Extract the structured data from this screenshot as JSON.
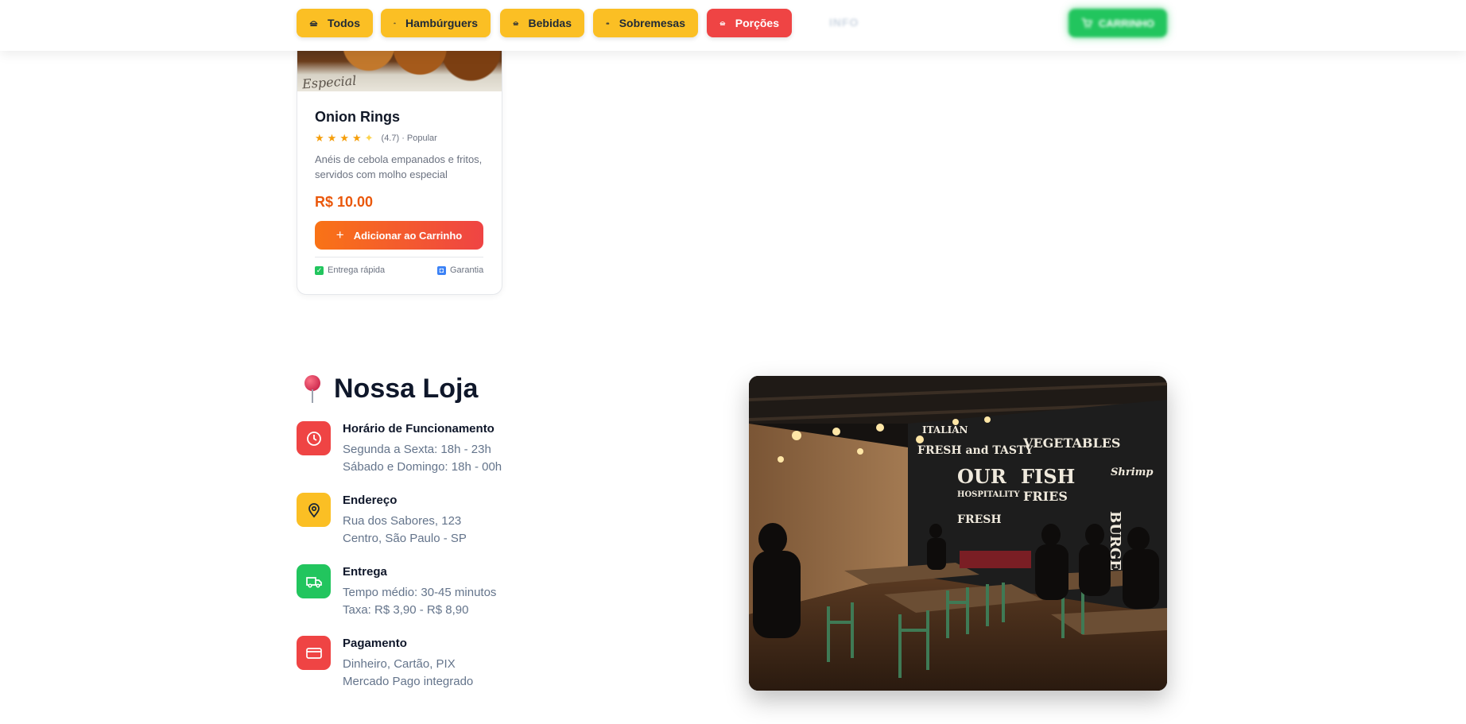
{
  "nav": {
    "categories": [
      {
        "label": "Todos",
        "icon": "burger-icon",
        "color": "#fbbf24"
      },
      {
        "label": "Hambúrguers",
        "icon": "burger-icon",
        "color": "#fbbf24"
      },
      {
        "label": "Bebidas",
        "icon": "burger-icon",
        "color": "#fbbf24"
      },
      {
        "label": "Sobremesas",
        "icon": "burger-icon",
        "color": "#fbbf24"
      },
      {
        "label": "Porções",
        "icon": "burger-icon",
        "color": "#ef4444",
        "active": true
      }
    ],
    "info_label": "INFO",
    "cart_label": "CARRINHO"
  },
  "product": {
    "name": "Onion Rings",
    "rating": 4.7,
    "rating_text": "(4.7) · Popular",
    "description": "Anéis de cebola empanados e fritos, servidos com molho especial",
    "price": "R$ 10.00",
    "add_label": "Adicionar ao Carrinho",
    "features": [
      "Entrega rápida",
      "Garantia"
    ],
    "image_text": "Especial"
  },
  "store": {
    "title": "Nossa Loja",
    "items": [
      {
        "title": "Horário de Funcionamento",
        "lines": [
          "Segunda a Sexta: 18h - 23h",
          "Sábado e Domingo: 18h - 00h"
        ],
        "icon": "clock-icon",
        "color": "#ef4444"
      },
      {
        "title": "Endereço",
        "lines": [
          "Rua dos Sabores, 123",
          "Centro, São Paulo - SP"
        ],
        "icon": "map-pin-icon",
        "color": "#fbbf24"
      },
      {
        "title": "Entrega",
        "lines": [
          "Tempo médio: 30-45 minutos",
          "Taxa: R$ 3,90 - R$ 8,90"
        ],
        "icon": "truck-icon",
        "color": "#22c55e"
      },
      {
        "title": "Pagamento",
        "lines": [
          "Dinheiro, Cartão, PIX",
          "Mercado Pago integrado"
        ],
        "icon": "credit-card-icon",
        "color": "#ef4444"
      }
    ],
    "photo_signs": [
      "ITALIAN",
      "FRESH and TASTY",
      "VEGETABLES",
      "OUR",
      "HOSPITALITY",
      "FISH",
      "FRIES",
      "BURGER",
      "FRESH",
      "Shrimp"
    ]
  },
  "colors": {
    "accent_orange": "#f97316",
    "accent_red": "#ef4444",
    "accent_yellow": "#fbbf24",
    "green": "#22c55e"
  }
}
